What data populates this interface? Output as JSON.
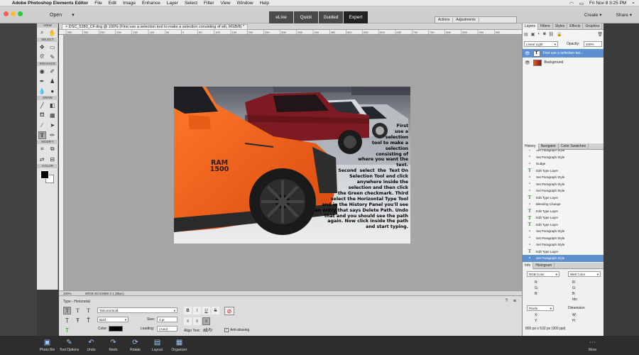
{
  "menubar": {
    "app": "Adobe Photoshop Elements Editor",
    "items": [
      "File",
      "Edit",
      "Image",
      "Enhance",
      "Layer",
      "Select",
      "Filter",
      "View",
      "Window",
      "Help"
    ],
    "clock": "Fri Nov 8  3:25 PM"
  },
  "appbar": {
    "open_label": "Open",
    "modes": [
      "eLive",
      "Quick",
      "Guided",
      "Expert"
    ],
    "active_mode": "Expert",
    "create_label": "Create",
    "share_label": "Share",
    "panel_tabs": [
      "Actions",
      "Adjustments"
    ]
  },
  "toolbox": {
    "sections": [
      "VIEW",
      "SELECT",
      "ENHANCE",
      "DRAW",
      "MODIFY",
      "COLOR"
    ]
  },
  "document": {
    "tab_title": "DSC_5280_CF.dng @ 100% (First use a selection tool to make a selection consisting of wh, RGB/8) *",
    "zoom": "100%",
    "profile": "sRGB IEC61966-2.1 (8bpc)",
    "ruler_marks": [
      "350",
      "300",
      "250",
      "200",
      "150",
      "100",
      "50",
      "0",
      "50",
      "100",
      "150",
      "200",
      "250",
      "300",
      "350",
      "400",
      "450",
      "500",
      "550",
      "600",
      "650",
      "700",
      "750",
      "800",
      "850",
      "900",
      "950"
    ],
    "overlay_text": [
      "First",
      "use a",
      "selection",
      "tool to make a",
      "selection",
      "consisting of",
      "where you want the",
      "text.",
      "Second  select  the  Text On",
      "Selection Tool and click",
      "anywhere inside the",
      "selection and then click",
      "the Green checkmark. Third",
      "select the Horizontal Type Tool",
      "and in the History Panel you'll see",
      "an entry that says Delete Path. Undo",
      "that and you should see the path",
      "again. Now click inside the path",
      "and start typing."
    ],
    "decal_brand": "RAM",
    "decal_model": "1500"
  },
  "options": {
    "title": "Type - Horizontal",
    "font_family": "Tahoma Bold",
    "font_style": "Bold",
    "size_label": "Size:",
    "size_value": "4 pt",
    "color_label": "Color:",
    "leading_label": "Leading:",
    "leading_value": "(Auto)",
    "style_buttons": [
      "B",
      "I",
      "U",
      "S"
    ],
    "anti_alias": "Anti-aliasing",
    "align_label": "Align Text:"
  },
  "layers_panel": {
    "tabs": [
      "Layers",
      "Filters",
      "Styles",
      "Effects",
      "Graphics"
    ],
    "blend_mode": "Linear Light",
    "opacity_label": "Opacity:",
    "opacity_value": "100%",
    "layers": [
      {
        "name": "First use a selection too...",
        "selected": true,
        "type": "text"
      },
      {
        "name": "Background",
        "selected": false,
        "type": "image"
      }
    ]
  },
  "history_panel": {
    "tabs": [
      "History",
      "Navigator",
      "Color Swatches"
    ],
    "items": [
      {
        "label": "Set Paragraph Style",
        "icon": "doc"
      },
      {
        "label": "Set Paragraph Style",
        "icon": "doc"
      },
      {
        "label": "Nudge",
        "icon": "doc"
      },
      {
        "label": "Edit Type Layer",
        "icon": "type"
      },
      {
        "label": "Set Paragraph Style",
        "icon": "doc"
      },
      {
        "label": "Set Paragraph Style",
        "icon": "doc"
      },
      {
        "label": "Set Paragraph Style",
        "icon": "doc"
      },
      {
        "label": "Edit Type Layer",
        "icon": "type"
      },
      {
        "label": "Blending Change",
        "icon": "doc"
      },
      {
        "label": "Edit Type Layer",
        "icon": "type"
      },
      {
        "label": "Edit Type Layer",
        "icon": "type"
      },
      {
        "label": "Edit Type Layer",
        "icon": "type"
      },
      {
        "label": "Set Paragraph Style",
        "icon": "doc"
      },
      {
        "label": "Set Paragraph Style",
        "icon": "doc"
      },
      {
        "label": "Set Paragraph Style",
        "icon": "doc"
      },
      {
        "label": "Edit Type Layer",
        "icon": "type"
      },
      {
        "label": "Set Paragraph Style",
        "icon": "doc",
        "selected": true
      }
    ]
  },
  "info_panel": {
    "tabs": [
      "Info",
      "Histogram"
    ],
    "left_mode": "RGB Color",
    "right_mode": "Web Color",
    "left_rows": [
      "R:",
      "G:",
      "B:"
    ],
    "right_rows": [
      "R:",
      "G:",
      "B:",
      "Idx:"
    ],
    "units": "Pixels",
    "x_label": "X:",
    "y_label": "Y:",
    "dimension_label": "Dimension",
    "w_label": "W:",
    "h_label": "H:",
    "doc_size": "800 px x 532 px (300 ppi)"
  },
  "bottombar": {
    "items": [
      "Photo Bin",
      "Tool Options",
      "Undo",
      "Redo",
      "Rotate",
      "Layout",
      "Organizer"
    ],
    "more_label": "More"
  }
}
